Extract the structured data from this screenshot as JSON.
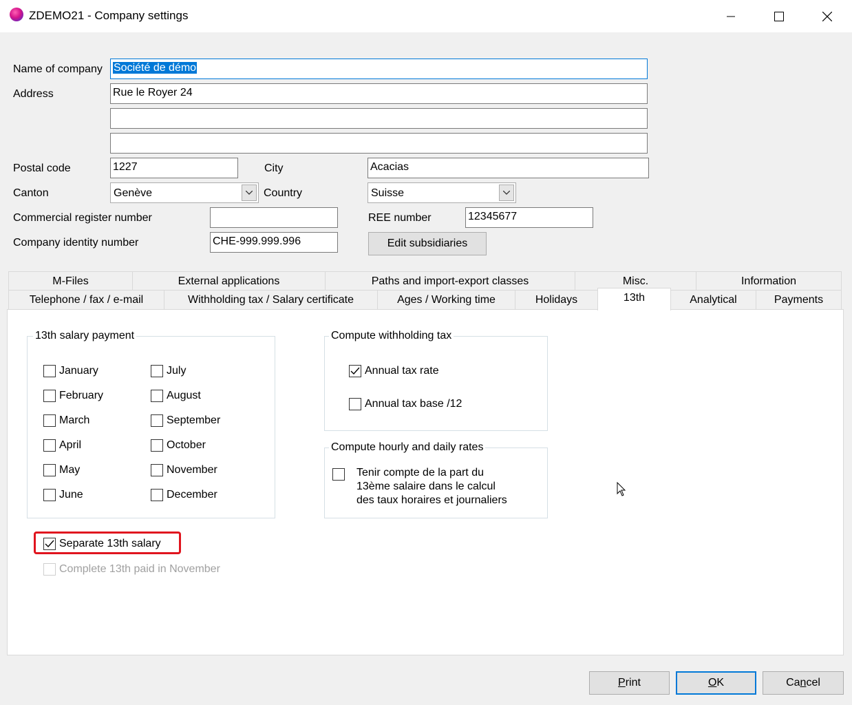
{
  "window": {
    "title": "ZDEMO21 - Company settings",
    "icons": {
      "app": "app-logo-icon",
      "minimize": "minimize-icon",
      "maximize": "maximize-icon",
      "close": "close-icon"
    }
  },
  "form": {
    "name_label": "Name of company",
    "name_value": "Société de démo",
    "address_label": "Address",
    "address_line1": "Rue le Royer 24",
    "address_line2": "",
    "address_line3": "",
    "postal_label": "Postal code",
    "postal_value": "1227",
    "city_label": "City",
    "city_value": "Acacias",
    "canton_label": "Canton",
    "canton_value": "Genève",
    "country_label": "Country",
    "country_value": "Suisse",
    "commercial_label": "Commercial register number",
    "commercial_value": "",
    "ree_label": "REE number",
    "ree_value": "12345677",
    "identity_label": "Company identity number",
    "identity_value": "CHE-999.999.996",
    "edit_subsidiaries": "Edit subsidiaries"
  },
  "tabs": {
    "row1": [
      "M-Files",
      "External applications",
      "Paths and import-export classes",
      "Misc.",
      "Information"
    ],
    "row2": [
      "Telephone / fax / e-mail",
      "Withholding tax / Salary certificate",
      "Ages / Working time",
      "Holidays",
      "13th",
      "Analytical",
      "Payments"
    ],
    "active": "13th"
  },
  "salary_group": {
    "title": "13th salary payment",
    "months_left": [
      {
        "label": "January",
        "checked": false
      },
      {
        "label": "February",
        "checked": false
      },
      {
        "label": "March",
        "checked": false
      },
      {
        "label": "April",
        "checked": false
      },
      {
        "label": "May",
        "checked": false
      },
      {
        "label": "June",
        "checked": false
      }
    ],
    "months_right": [
      {
        "label": "July",
        "checked": false
      },
      {
        "label": "August",
        "checked": false
      },
      {
        "label": "September",
        "checked": false
      },
      {
        "label": "October",
        "checked": false
      },
      {
        "label": "November",
        "checked": false
      },
      {
        "label": "December",
        "checked": false
      }
    ]
  },
  "withholding_group": {
    "title": "Compute  withholding tax",
    "annual_rate": {
      "label": "Annual tax rate",
      "checked": true
    },
    "annual_base": {
      "label": "Annual tax base /12",
      "checked": false
    }
  },
  "hourly_group": {
    "title": "Compute hourly and daily rates",
    "option_lines": [
      "Tenir compte de la part du",
      "13ème salaire dans le calcul",
      "des taux horaires et journaliers"
    ],
    "checked": false
  },
  "separate_13th": {
    "label": "Separate 13th salary",
    "checked": true
  },
  "complete_13th": {
    "label": "Complete 13th paid in November",
    "checked": false,
    "enabled": false
  },
  "buttons": {
    "print": {
      "first": "P",
      "rest": "rint"
    },
    "ok": {
      "first": "O",
      "rest": "K"
    },
    "cancel": {
      "first": "Ca",
      "u": "n",
      "rest": "cel"
    }
  }
}
